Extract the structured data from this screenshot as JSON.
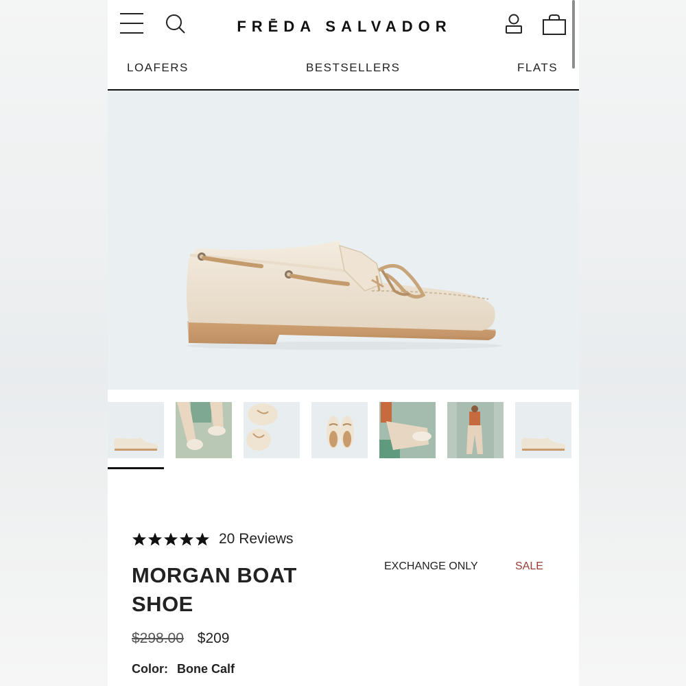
{
  "header": {
    "logo": "FRĒDA SALVADOR"
  },
  "nav": {
    "categories": [
      "LOAFERS",
      "BESTSELLERS",
      "FLATS"
    ]
  },
  "product": {
    "rating": 5,
    "reviews_label": "20 Reviews",
    "title": "MORGAN BOAT SHOE",
    "exchange_label": "EXCHANGE ONLY",
    "sale_label": "SALE",
    "original_price": "$298.00",
    "sale_price": "$209",
    "color_label": "Color:",
    "color_value": "Bone Calf"
  },
  "colors": {
    "sale": "#9a3a34",
    "hero_background": "#eaeff1",
    "shoe_body": "#efe4d2",
    "sole": "#c89b6d"
  },
  "thumbnails": {
    "count": 7,
    "active_index": 0
  }
}
